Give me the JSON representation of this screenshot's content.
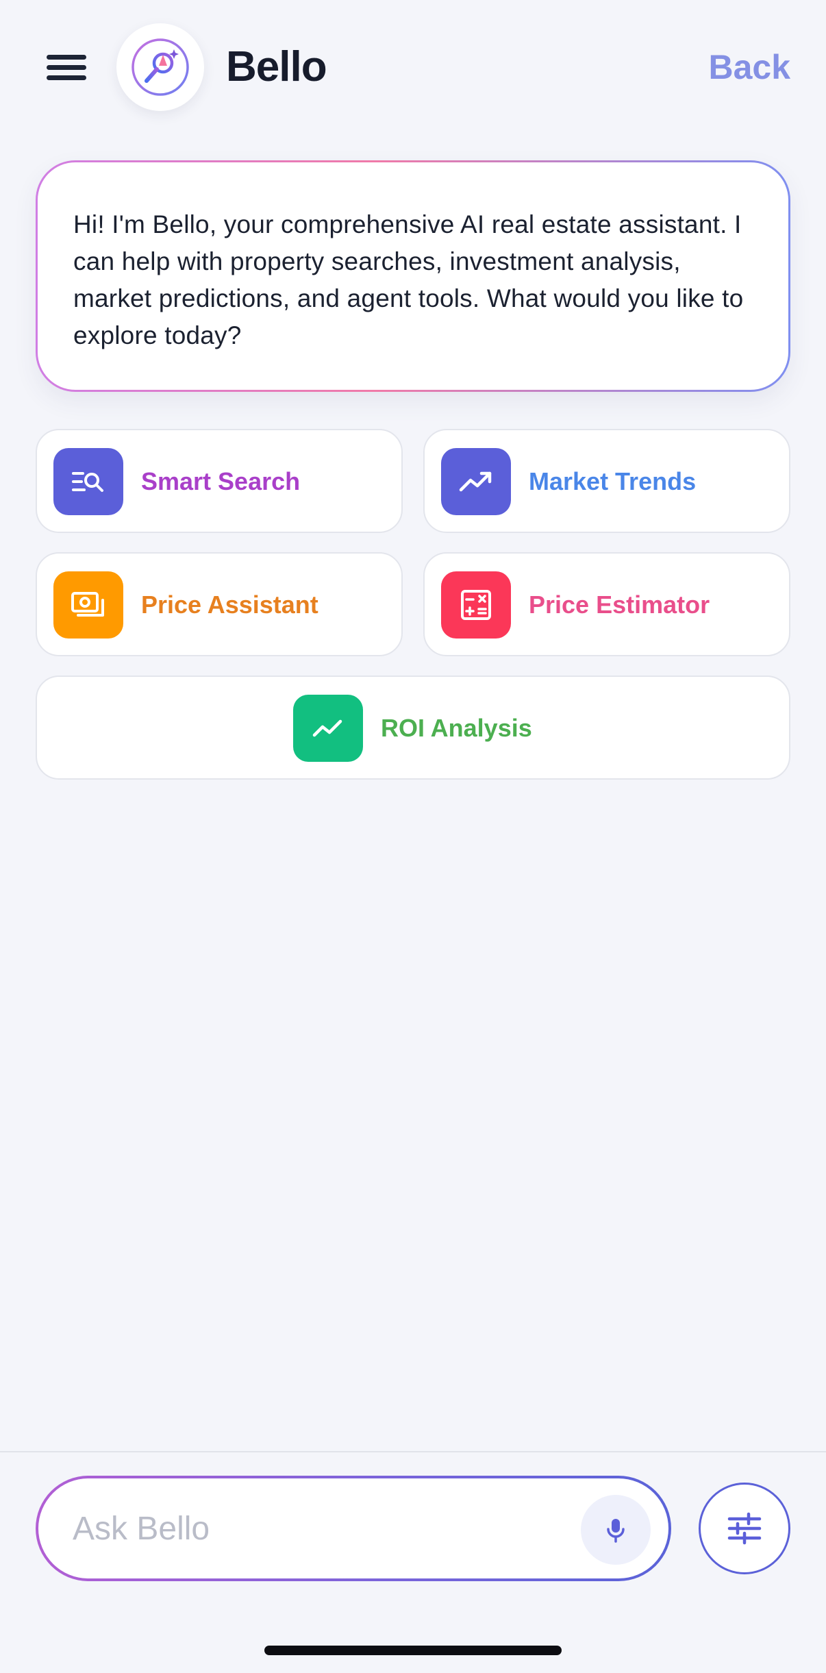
{
  "header": {
    "title": "Bello",
    "back_label": "Back"
  },
  "greeting": {
    "text": "Hi! I'm Bello, your comprehensive AI real estate assistant. I can help with property searches, investment analysis, market predictions, and agent tools. What would you like to explore today?"
  },
  "actions": [
    {
      "label": "Smart Search",
      "icon": "search-list-icon",
      "color": "#a93fc9",
      "icon_bg": "#5b5fd9"
    },
    {
      "label": "Market Trends",
      "icon": "trending-up-icon",
      "color": "#4a86e8",
      "icon_bg": "#5b5fd9"
    },
    {
      "label": "Price Assistant",
      "icon": "cash-icon",
      "color": "#e7801f",
      "icon_bg": "#ff9a00"
    },
    {
      "label": "Price Estimator",
      "icon": "calculator-icon",
      "color": "#e94e8b",
      "icon_bg": "#fb3758"
    },
    {
      "label": "ROI Analysis",
      "icon": "chart-line-icon",
      "color": "#4caf50",
      "icon_bg": "#12bf80"
    }
  ],
  "composer": {
    "placeholder": "Ask Bello",
    "mic_icon": "microphone-icon",
    "filter_icon": "sliders-icon"
  }
}
